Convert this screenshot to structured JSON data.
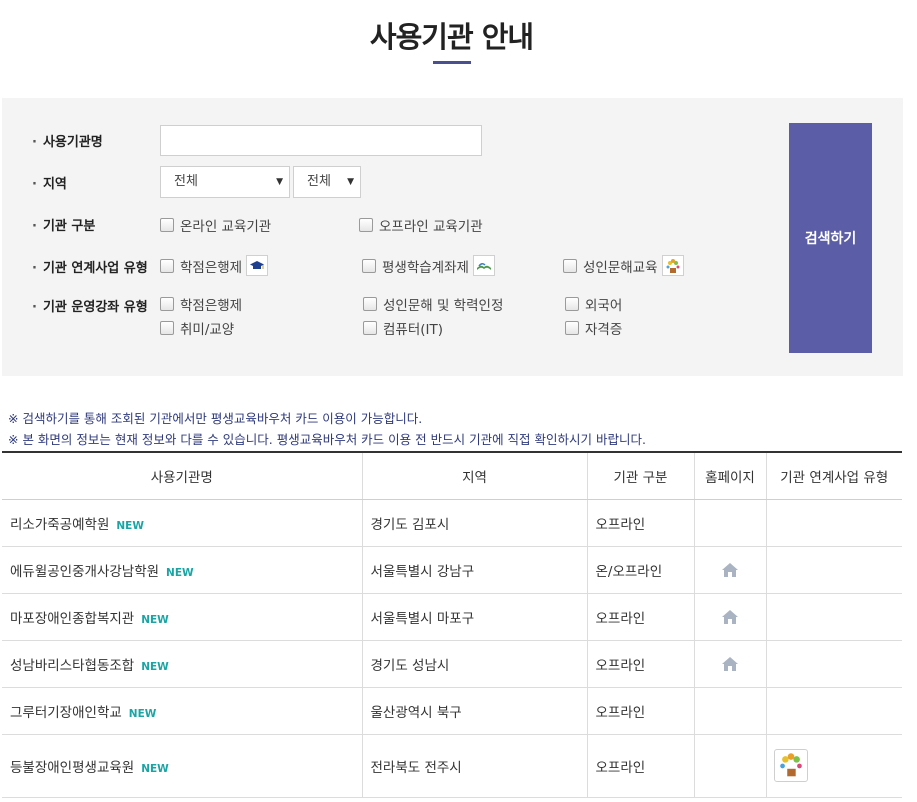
{
  "page": {
    "title": "사용기관 안내"
  },
  "search": {
    "fields": {
      "name_label": "사용기관명",
      "region_label": "지역",
      "type_label": "기관 구분",
      "biz_label": "기관 연계사업 유형",
      "course_label": "기관 운영강좌 유형"
    },
    "region_select_1": "전체",
    "region_select_2": "전체",
    "type_options": [
      "온라인 교육기관",
      "오프라인 교육기관"
    ],
    "biz_options": [
      "학점은행제",
      "평생학습계좌제",
      "성인문해교육"
    ],
    "course_options": [
      "학점은행제",
      "성인문해 및 학력인정",
      "외국어",
      "취미/교양",
      "컴퓨터(IT)",
      "자격증"
    ],
    "button_label": "검색하기"
  },
  "notices": [
    "※ 검색하기를 통해 조회된 기관에서만 평생교육바우처 카드 이용이 가능합니다.",
    "※ 본 화면의 정보는 현재 정보와 다를 수 있습니다. 평생교육바우처 카드 이용 전 반드시 기관에 직접 확인하시기 바랍니다."
  ],
  "table": {
    "headers": [
      "사용기관명",
      "지역",
      "기관 구분",
      "홈페이지",
      "기관 연계사업 유형"
    ],
    "new_label": "NEW",
    "rows": [
      {
        "name": "리소가죽공예학원",
        "region": "경기도 김포시",
        "type": "오프라인",
        "homepage": false,
        "biz_icon": false
      },
      {
        "name": "에듀윌공인중개사강남학원",
        "region": "서울특별시 강남구",
        "type": "온/오프라인",
        "homepage": true,
        "biz_icon": false
      },
      {
        "name": "마포장애인종합복지관",
        "region": "서울특별시 마포구",
        "type": "오프라인",
        "homepage": true,
        "biz_icon": false
      },
      {
        "name": "성남바리스타협동조합",
        "region": "경기도 성남시",
        "type": "오프라인",
        "homepage": true,
        "biz_icon": false
      },
      {
        "name": "그루터기장애인학교",
        "region": "울산광역시 북구",
        "type": "오프라인",
        "homepage": false,
        "biz_icon": false
      },
      {
        "name": "등불장애인평생교육원",
        "region": "전라북도 전주시",
        "type": "오프라인",
        "homepage": false,
        "biz_icon": true
      }
    ]
  },
  "icons": {
    "homepage": "home-icon",
    "biz_credit_bank": "graduation-cap-icon",
    "biz_account": "book-icon",
    "biz_literacy": "flower-pot-icon"
  },
  "colors": {
    "accent": "#5b5ea6",
    "notice": "#2f3a7c",
    "new": "#1aa5a5"
  }
}
